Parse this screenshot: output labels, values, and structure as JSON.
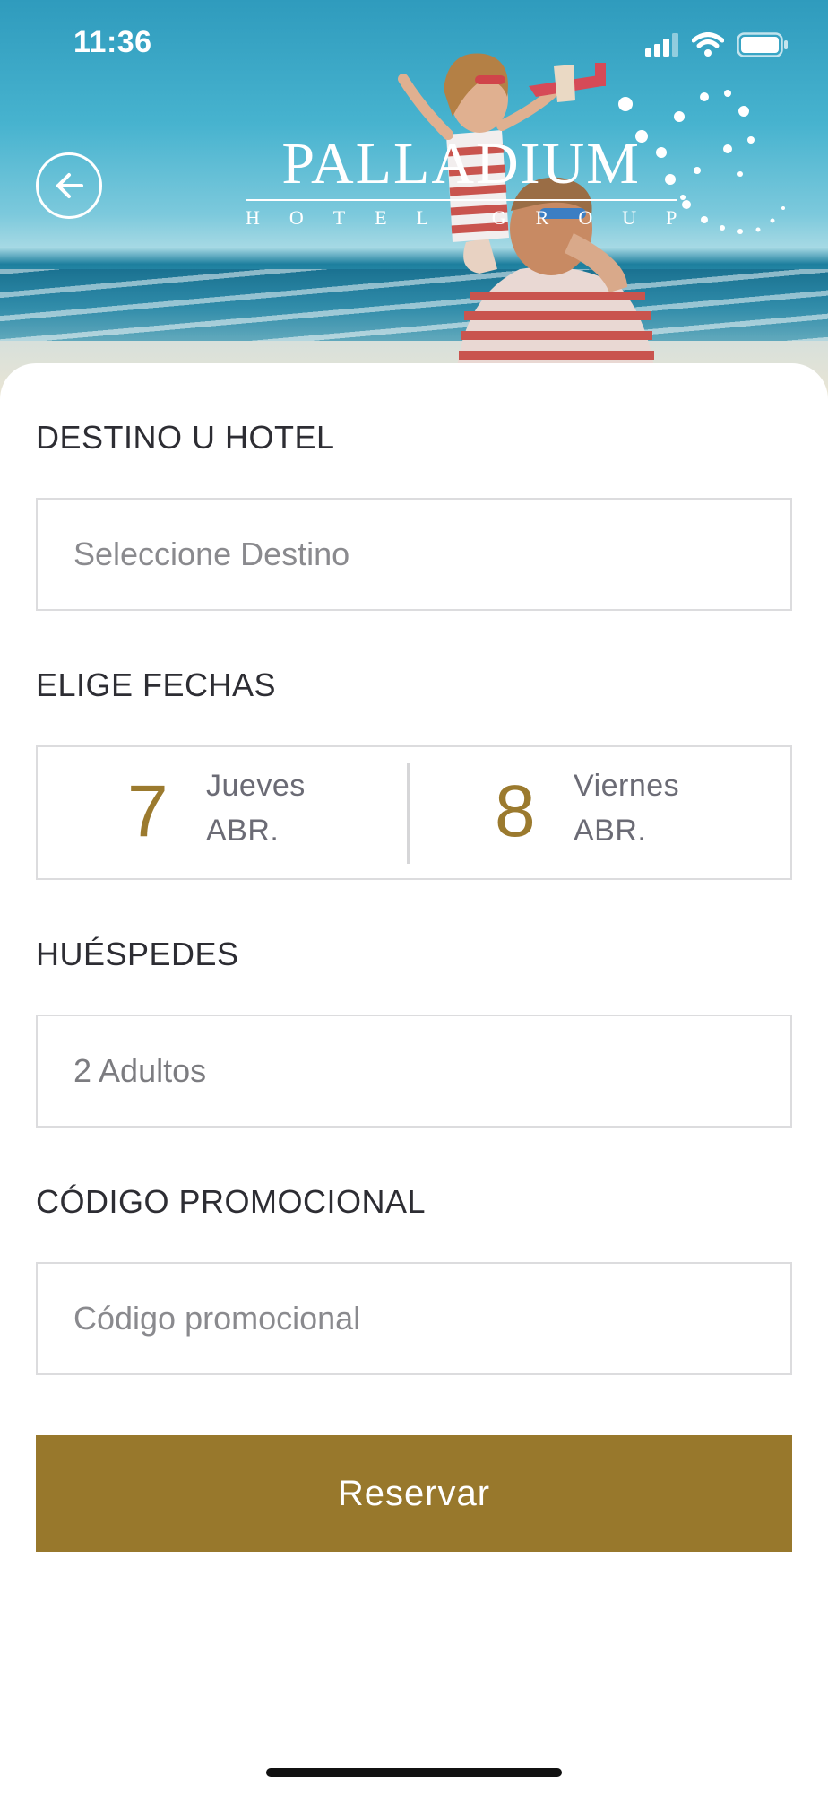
{
  "status_bar": {
    "time": "11:36",
    "icons": [
      "signal-bars-icon",
      "wifi-icon",
      "battery-icon"
    ]
  },
  "header": {
    "back_icon": "arrow-left-circle-icon",
    "logo_name": "PALLADIUM",
    "logo_sub": "HOTEL GROUP"
  },
  "form": {
    "destination": {
      "label": "DESTINO U HOTEL",
      "placeholder": "Seleccione Destino"
    },
    "dates": {
      "label": "ELIGE FECHAS",
      "check_in": {
        "day": "7",
        "weekday": "Jueves",
        "month": "ABR."
      },
      "check_out": {
        "day": "8",
        "weekday": "Viernes",
        "month": "ABR."
      }
    },
    "guests": {
      "label": "HUÉSPEDES",
      "value": "2 Adultos"
    },
    "promo": {
      "label": "CÓDIGO PROMOCIONAL",
      "placeholder": "Código promocional"
    },
    "submit_label": "Reservar"
  },
  "colors": {
    "accent": "#98782C",
    "date_number": "#9B7A2E",
    "label": "#2D2D33",
    "border": "#DCDCDE"
  }
}
